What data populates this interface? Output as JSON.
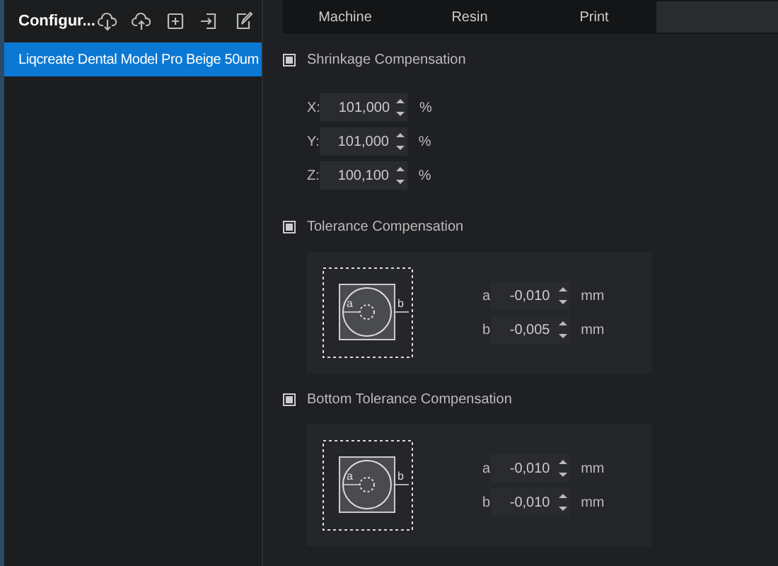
{
  "sidebar": {
    "title": "Configur...",
    "items": [
      {
        "label": "Liqcreate Dental Model Pro Beige 50um",
        "selected": true
      }
    ]
  },
  "tabs": [
    {
      "label": "Machine",
      "selected": false
    },
    {
      "label": "Resin",
      "selected": false
    },
    {
      "label": "Print",
      "selected": false
    },
    {
      "selected": true
    }
  ],
  "sections": [
    {
      "kind": "axes",
      "title": "Shrinkage Compensation",
      "checked": true,
      "rows": [
        {
          "label": "X:",
          "value": "101,000",
          "unit": "%"
        },
        {
          "label": "Y:",
          "value": "101,000",
          "unit": "%"
        },
        {
          "label": "Z:",
          "value": "100,100",
          "unit": "%"
        }
      ]
    },
    {
      "kind": "tolerance",
      "title": "Tolerance Compensation",
      "checked": true,
      "diagram_labels": [
        "a",
        "b"
      ],
      "rows": [
        {
          "label": "a",
          "value": "-0,010",
          "unit": "mm"
        },
        {
          "label": "b",
          "value": "-0,005",
          "unit": "mm"
        }
      ]
    },
    {
      "kind": "tolerance",
      "title": "Bottom Tolerance Compensation",
      "checked": true,
      "diagram_labels": [
        "a",
        "b"
      ],
      "rows": [
        {
          "label": "a",
          "value": "-0,010",
          "unit": "mm"
        },
        {
          "label": "b",
          "value": "-0,010",
          "unit": "mm"
        }
      ]
    }
  ]
}
